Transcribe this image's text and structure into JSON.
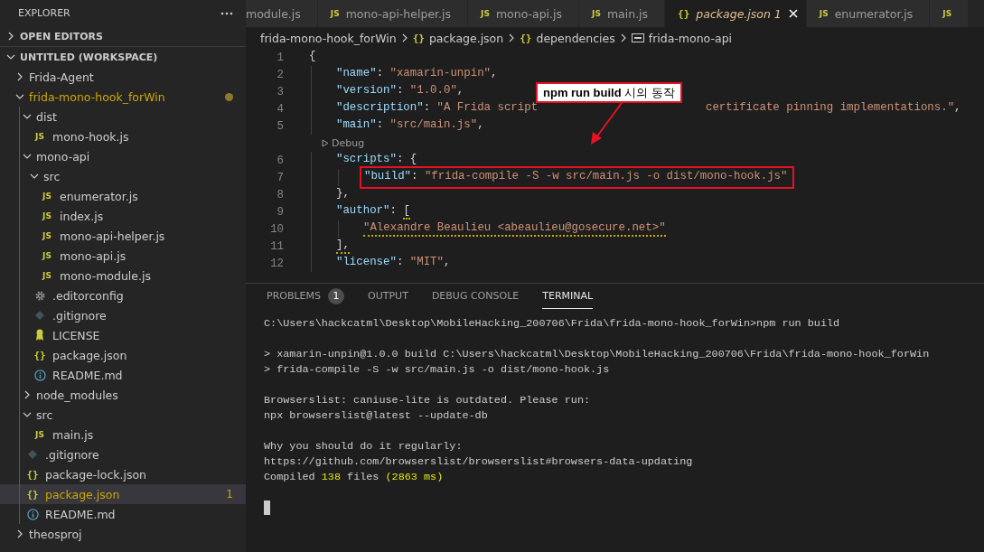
{
  "explorer": {
    "title": "EXPLORER",
    "sections": [
      {
        "label": "OPEN EDITORS",
        "expanded": false
      },
      {
        "label": "UNTITLED (WORKSPACE)",
        "expanded": true
      }
    ],
    "tree": [
      {
        "label": "Frida-Agent",
        "kind": "folder",
        "expanded": false
      },
      {
        "label": "frida-mono-hook_forWin",
        "kind": "folder",
        "expanded": true,
        "modified": true,
        "children": [
          {
            "label": "dist",
            "kind": "folder",
            "expanded": true,
            "children": [
              {
                "label": "mono-hook.js",
                "kind": "js",
                "icon": "JS"
              }
            ]
          },
          {
            "label": "mono-api",
            "kind": "folder",
            "expanded": true,
            "children": [
              {
                "label": "src",
                "kind": "folder",
                "expanded": true,
                "children": [
                  {
                    "label": "enumerator.js",
                    "kind": "js",
                    "icon": "JS"
                  },
                  {
                    "label": "index.js",
                    "kind": "js",
                    "icon": "JS"
                  },
                  {
                    "label": "mono-api-helper.js",
                    "kind": "js",
                    "icon": "JS"
                  },
                  {
                    "label": "mono-api.js",
                    "kind": "js",
                    "icon": "JS"
                  },
                  {
                    "label": "mono-module.js",
                    "kind": "js",
                    "icon": "JS"
                  }
                ]
              },
              {
                "label": ".editorconfig",
                "kind": "gear"
              },
              {
                "label": ".gitignore",
                "kind": "git"
              },
              {
                "label": "LICENSE",
                "kind": "license"
              },
              {
                "label": "package.json",
                "kind": "json",
                "icon": "{}"
              },
              {
                "label": "README.md",
                "kind": "info"
              }
            ]
          },
          {
            "label": "node_modules",
            "kind": "folder",
            "expanded": false
          },
          {
            "label": "src",
            "kind": "folder",
            "expanded": true,
            "children": [
              {
                "label": "main.js",
                "kind": "js",
                "icon": "JS"
              }
            ]
          },
          {
            "label": ".gitignore",
            "kind": "git"
          },
          {
            "label": "package-lock.json",
            "kind": "json",
            "icon": "{}"
          },
          {
            "label": "package.json",
            "kind": "json",
            "icon": "{}",
            "selected": true,
            "modified": true,
            "badge": "1"
          },
          {
            "label": "README.md",
            "kind": "info"
          }
        ]
      },
      {
        "label": "theosproj",
        "kind": "folder",
        "expanded": false
      }
    ]
  },
  "tabs": [
    {
      "label": "module.js",
      "kind": "plain",
      "selected": false
    },
    {
      "label": "mono-api-helper.js",
      "kind": "js",
      "icon": "JS",
      "selected": false
    },
    {
      "label": "mono-api.js",
      "kind": "js",
      "icon": "JS",
      "selected": false
    },
    {
      "label": "main.js",
      "kind": "js",
      "icon": "JS",
      "selected": false
    },
    {
      "label": "package.json 1",
      "kind": "json",
      "icon": "{}",
      "selected": true
    },
    {
      "label": "enumerator.js",
      "kind": "js",
      "icon": "JS",
      "selected": false
    },
    {
      "kind": "js",
      "icon": "JS",
      "selected": false
    }
  ],
  "breadcrumb": [
    {
      "label": "frida-mono-hook_forWin",
      "kind": "folder"
    },
    {
      "label": "package.json",
      "kind": "json",
      "icon": "{}"
    },
    {
      "label": "dependencies",
      "kind": "json",
      "icon": "{}"
    },
    {
      "label": "frida-mono-api",
      "kind": "string"
    }
  ],
  "code": [
    {
      "kind": "line",
      "number": "1",
      "tokens": [
        {
          "kind": "punct",
          "text": "{"
        }
      ],
      "children": [
        {
          "kind": "line",
          "number": "2",
          "tokens": [
            {
              "kind": "key",
              "text": "\"name\""
            },
            {
              "kind": "punct",
              "text": ": "
            },
            {
              "kind": "str",
              "text": "\"xamarin-unpin\""
            },
            {
              "kind": "punct",
              "text": ","
            }
          ]
        },
        {
          "kind": "line",
          "number": "3",
          "tokens": [
            {
              "kind": "key",
              "text": "\"version\""
            },
            {
              "kind": "punct",
              "text": ": "
            },
            {
              "kind": "str",
              "text": "\"1.0.0\""
            },
            {
              "kind": "punct",
              "text": ","
            }
          ]
        },
        {
          "kind": "line",
          "number": "4",
          "tokens": [
            {
              "kind": "key",
              "text": "\"description\""
            },
            {
              "kind": "punct",
              "text": ": "
            },
            {
              "kind": "str",
              "text": "\"A Frida script"
            },
            {
              "kind": "hidden"
            },
            {
              "kind": "str",
              "text": "certificate pinning implementations.\""
            },
            {
              "kind": "punct",
              "text": ","
            }
          ]
        },
        {
          "kind": "line",
          "number": "5",
          "tokens": [
            {
              "kind": "key",
              "text": "\"main\""
            },
            {
              "kind": "punct",
              "text": ": "
            },
            {
              "kind": "str",
              "text": "\"src/main.js\""
            },
            {
              "kind": "punct",
              "text": ","
            }
          ]
        },
        {
          "kind": "codelens",
          "text": "Debug"
        },
        {
          "kind": "line",
          "number": "6",
          "tokens": [
            {
              "kind": "key",
              "text": "\"scripts\""
            },
            {
              "kind": "punct",
              "text": ": {"
            }
          ],
          "children": [
            {
              "kind": "line",
              "number": "7",
              "boxed": true,
              "tokens": [
                {
                  "kind": "key",
                  "text": "\"build\""
                },
                {
                  "kind": "punct",
                  "text": ": "
                },
                {
                  "kind": "str",
                  "text": "\"frida-compile -S -w src/main.js -o dist/mono-hook.js\""
                }
              ]
            }
          ]
        },
        {
          "kind": "line",
          "number": "8",
          "tokens": [
            {
              "kind": "punct",
              "text": "},"
            }
          ]
        },
        {
          "kind": "line",
          "number": "9",
          "tokens": [
            {
              "kind": "key",
              "text": "\"author\""
            },
            {
              "kind": "punct",
              "text": ": "
            },
            {
              "kind": "punct",
              "text": "[",
              "warning": true
            }
          ],
          "children": [
            {
              "kind": "line",
              "number": "10",
              "tokens": [
                {
                  "kind": "str",
                  "text": "\"Alexandre Beaulieu <abeaulieu@gosecure.net>\"",
                  "warning": true
                }
              ]
            }
          ]
        },
        {
          "kind": "line",
          "number": "11",
          "tokens": [
            {
              "kind": "punct",
              "text": "],",
              "warning": true
            }
          ]
        },
        {
          "kind": "line",
          "number": "12",
          "tokens": [
            {
              "kind": "key",
              "text": "\"license\""
            },
            {
              "kind": "punct",
              "text": ": "
            },
            {
              "kind": "str",
              "text": "\"MIT\""
            },
            {
              "kind": "punct",
              "text": ","
            }
          ]
        }
      ]
    }
  ],
  "callout": {
    "text": "**npm run build** 시의 동작"
  },
  "panel": {
    "tabs": [
      {
        "label": "PROBLEMS",
        "badge": "1",
        "selected": false
      },
      {
        "label": "OUTPUT",
        "selected": false
      },
      {
        "label": "DEBUG CONSOLE",
        "selected": false
      },
      {
        "label": "TERMINAL",
        "selected": true
      }
    ],
    "terminal": [
      [
        [
          {
            "text": "C:\\Users\\hackcatml\\Desktop\\MobileHacking_200706\\Frida\\frida-mono-hook_forWin>npm run build"
          }
        ]
      ],
      [
        [
          {
            "text": "> xamarin-unpin@1.0.0 build C:\\Users\\hackcatml\\Desktop\\MobileHacking_200706\\Frida\\frida-mono-hook_forWin"
          }
        ],
        [
          {
            "text": "> frida-compile -S -w src/main.js -o dist/mono-hook.js"
          }
        ]
      ],
      [
        [
          {
            "text": "Browserslist: caniuse-lite is outdated. Please run:"
          }
        ],
        [
          {
            "text": "npx browserslist@latest --update-db"
          }
        ]
      ],
      [
        [
          {
            "text": "Why you should do it regularly:"
          }
        ],
        [
          {
            "text": "https://github.com/browserslist/browserslist#browsers-data-updating"
          }
        ],
        [
          {
            "text": "Compiled "
          },
          {
            "text": "138",
            "highlight": true
          },
          {
            "text": " files "
          },
          {
            "text": "(2863 ms)",
            "highlight": true
          }
        ]
      ]
    ],
    "cursor": true
  }
}
